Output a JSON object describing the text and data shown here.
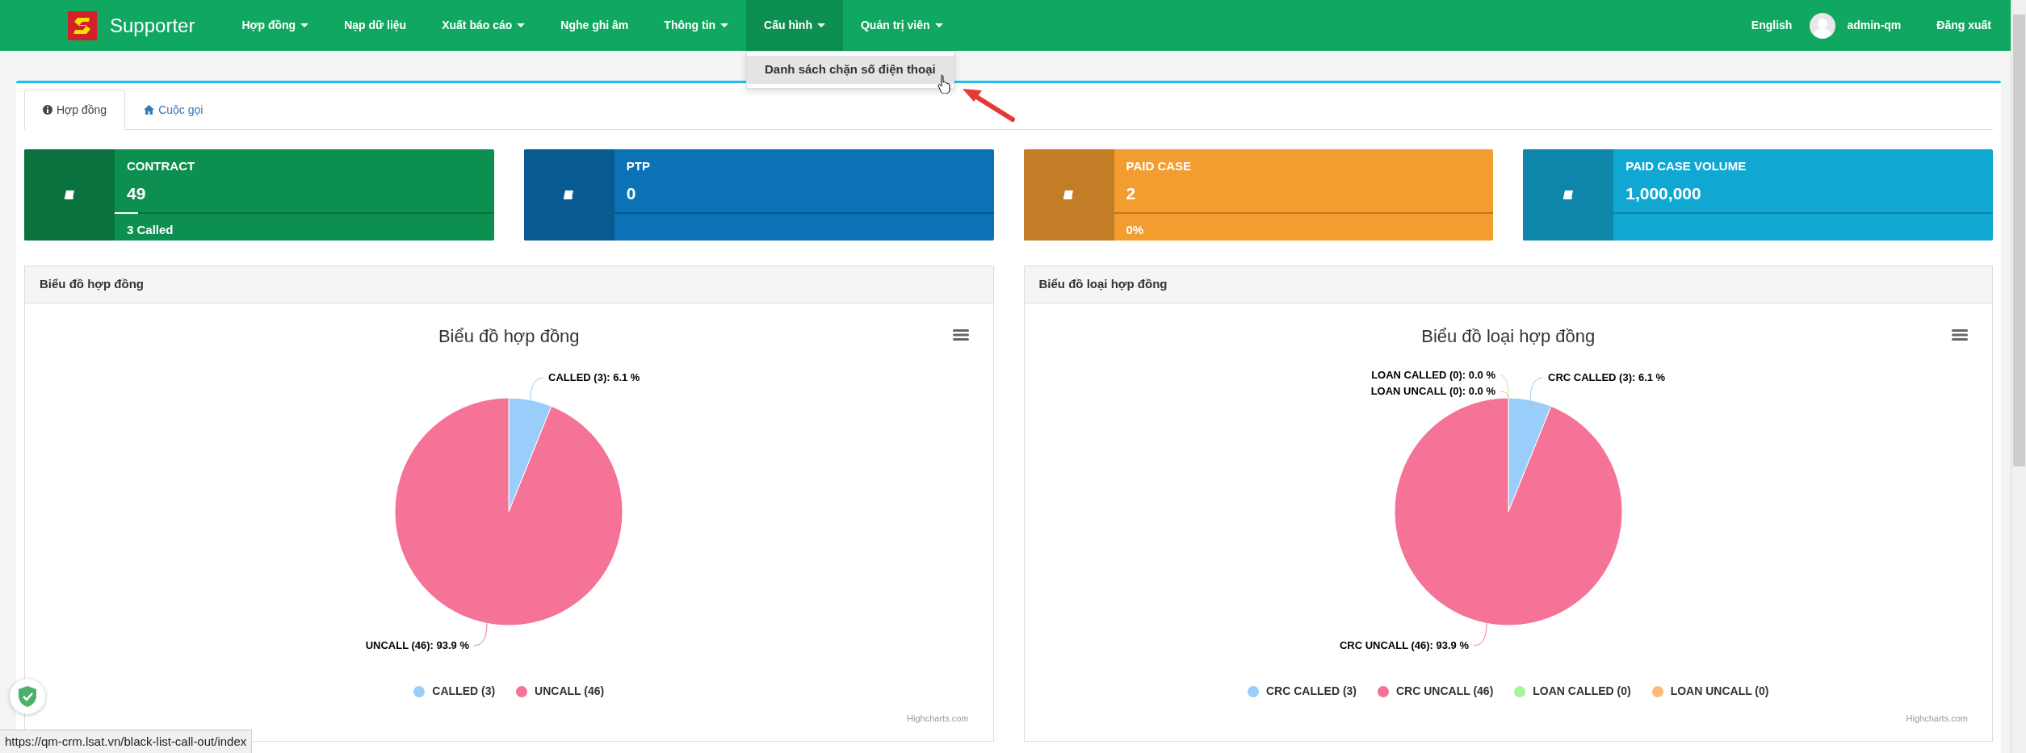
{
  "navbar": {
    "brand": "Supporter",
    "menu": [
      {
        "label": "Hợp đồng",
        "has_caret": true,
        "expanded": false
      },
      {
        "label": "Nạp dữ liệu",
        "has_caret": false,
        "expanded": false
      },
      {
        "label": "Xuất báo cáo",
        "has_caret": true,
        "expanded": false
      },
      {
        "label": "Nghe ghi âm",
        "has_caret": false,
        "expanded": false
      },
      {
        "label": "Thông tin",
        "has_caret": true,
        "expanded": false
      },
      {
        "label": "Cấu hình",
        "has_caret": true,
        "expanded": true
      },
      {
        "label": "Quản trị viên",
        "has_caret": true,
        "expanded": false
      }
    ],
    "language": "English",
    "user": "admin-qm",
    "logout": "Đăng xuất"
  },
  "dropdown": {
    "items": [
      {
        "label": "Danh sách chặn số điện thoại",
        "hovered": true
      }
    ]
  },
  "tabs": [
    {
      "label": "Hợp đồng",
      "kind": "info",
      "selected": true
    },
    {
      "label": "Cuộc gọi",
      "kind": "home",
      "selected": false
    }
  ],
  "stat_cards": [
    {
      "title": "CONTRACT",
      "value": "49",
      "level": 0.061,
      "footer": "3 Called",
      "color": "#0c8f4f"
    },
    {
      "title": "PTP",
      "value": "0",
      "level": 0,
      "color": "#0a72b5"
    },
    {
      "title": "PAID CASE",
      "value": "2",
      "level": 0,
      "footer": "0%",
      "color": "#f39c2f"
    },
    {
      "title": "PAID CASE VOLUME",
      "value": "1,000,000",
      "level": 0,
      "color": "#10a8d3"
    }
  ],
  "charts": [
    {
      "heading": "Biểu đồ hợp đồng",
      "credit": "Highcharts.com",
      "chart_data": {
        "type": "pie",
        "title": "Biểu đồ hợp đồng",
        "categories": [
          "CALLED (3)",
          "UNCALL (46)"
        ],
        "values": [
          3,
          46
        ],
        "legend": "bottom",
        "colors": [
          "#99cdfa",
          "#f47396"
        ],
        "value_labels": [
          "CALLED (3): 6.1 %",
          "UNCALL (46): 93.9 %"
        ]
      }
    },
    {
      "heading": "Biểu đồ loại hợp đồng",
      "credit": "Highcharts.com",
      "chart_data": {
        "type": "pie",
        "title": "Biểu đồ loại hợp đồng",
        "categories": [
          "CRC CALLED (3)",
          "CRC UNCALL (46)",
          "LOAN CALLED (0)",
          "LOAN UNCALL (0)"
        ],
        "values": [
          3,
          46,
          0,
          0
        ],
        "legend": "bottom",
        "colors": [
          "#99cdfa",
          "#f47396",
          "#a6f59c",
          "#fdba78"
        ],
        "value_labels": [
          "CRC CALLED (3): 6.1 %",
          "CRC UNCALL (46): 93.9 %",
          "LOAN CALLED (0): 0.0 %",
          "LOAN UNCALL (0): 0.0 %"
        ]
      }
    }
  ],
  "status_bar": {
    "url": "https://qm-crm.lsat.vn/black-list-call-out/index"
  }
}
